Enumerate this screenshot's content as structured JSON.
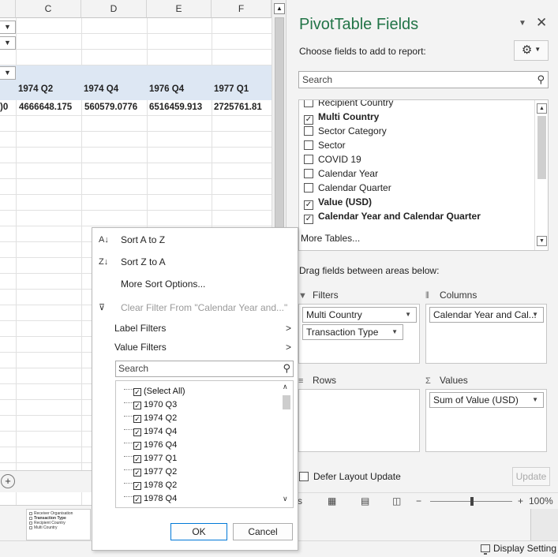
{
  "sheet": {
    "columns": [
      "C",
      "D",
      "E",
      "F"
    ],
    "header_row": [
      "1974 Q2",
      "1974 Q4",
      "1976 Q4",
      "1977 Q1"
    ],
    "value_row": [
      "4666648.175",
      "560579.0776",
      "6516459.913",
      "2725761.81"
    ],
    "left_cut_value": ")0"
  },
  "pane": {
    "title": "PivotTable Fields",
    "choose_label": "Choose fields to add to report:",
    "search_placeholder": "Search",
    "fields": [
      {
        "label": "Recipient Country",
        "checked": false,
        "bold": false
      },
      {
        "label": "Multi Country",
        "checked": true,
        "bold": true
      },
      {
        "label": "Sector Category",
        "checked": false,
        "bold": false
      },
      {
        "label": "Sector",
        "checked": false,
        "bold": false
      },
      {
        "label": "COVID 19",
        "checked": false,
        "bold": false
      },
      {
        "label": "Calendar Year",
        "checked": false,
        "bold": false
      },
      {
        "label": "Calendar Quarter",
        "checked": false,
        "bold": false
      },
      {
        "label": "Value (USD)",
        "checked": true,
        "bold": true
      },
      {
        "label": "Calendar Year and Calendar Quarter",
        "checked": true,
        "bold": true
      }
    ],
    "more_tables": "More Tables...",
    "drag_label": "Drag fields between areas below:",
    "areas": {
      "filters": {
        "title": "Filters",
        "chips": [
          "Multi Country",
          "Transaction Type"
        ]
      },
      "columns": {
        "title": "Columns",
        "chips": [
          "Calendar Year and Cal..."
        ]
      },
      "rows": {
        "title": "Rows",
        "chips": []
      },
      "values": {
        "title": "Values",
        "chips": [
          "Sum of Value (USD)"
        ]
      }
    },
    "defer_label": "Defer Layout Update",
    "update_label": "Update"
  },
  "status": {
    "zoom": "100%",
    "display_settings": "Display Setting",
    "left_cut": "s"
  },
  "filter_menu": {
    "sort_az": "Sort A to Z",
    "sort_za": "Sort Z to A",
    "more_sort": "More Sort Options...",
    "clear_filter": "Clear Filter From \"Calendar Year and...\"",
    "label_filters": "Label Filters",
    "value_filters": "Value Filters",
    "search_placeholder": "Search",
    "values": [
      "(Select All)",
      "1970 Q3",
      "1974 Q2",
      "1974 Q4",
      "1976 Q4",
      "1977 Q1",
      "1977 Q2",
      "1978 Q2",
      "1978 Q4"
    ],
    "ok": "OK",
    "cancel": "Cancel"
  },
  "thumbnail": {
    "items": [
      "Receiver Organisation",
      "Transaction Type",
      "Recipient Country",
      "Multi Country"
    ]
  }
}
